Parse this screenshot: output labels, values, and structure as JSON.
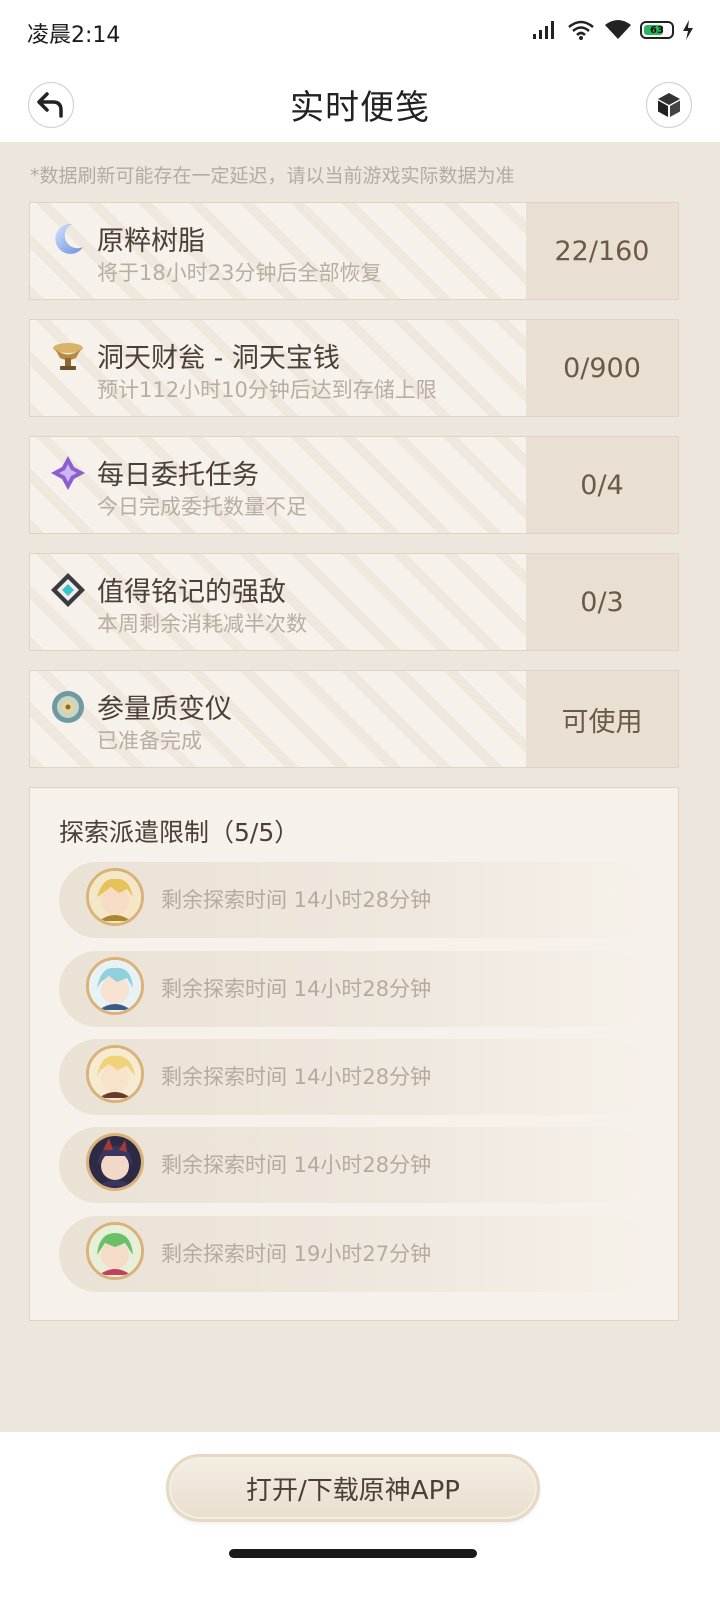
{
  "status_bar": {
    "time": "凌晨2:14",
    "battery": "63"
  },
  "header": {
    "title": "实时便笺"
  },
  "disclaimer": "*数据刷新可能存在一定延迟，请以当前游戏实际数据为准",
  "cards": [
    {
      "title": "原粹树脂",
      "subtitle": "将于18小时23分钟后全部恢复",
      "value": "22/160",
      "icon": "moon-icon"
    },
    {
      "title": "洞天财瓮 - 洞天宝钱",
      "subtitle": "预计112小时10分钟后达到存储上限",
      "value": "0/900",
      "icon": "teapot-icon"
    },
    {
      "title": "每日委托任务",
      "subtitle": "今日完成委托数量不足",
      "value": "0/4",
      "icon": "star-icon"
    },
    {
      "title": "值得铭记的强敌",
      "subtitle": "本周剩余消耗减半次数",
      "value": "0/3",
      "icon": "diamond-icon"
    },
    {
      "title": "参量质变仪",
      "subtitle": "已准备完成",
      "value": "可使用",
      "icon": "transformer-icon"
    }
  ],
  "expedition": {
    "title": "探索派遣限制（5/5）",
    "items": [
      {
        "text": "剩余探索时间 14小时28分钟",
        "avatar": "character-avatar-1"
      },
      {
        "text": "剩余探索时间 14小时28分钟",
        "avatar": "character-avatar-2"
      },
      {
        "text": "剩余探索时间 14小时28分钟",
        "avatar": "character-avatar-3"
      },
      {
        "text": "剩余探索时间 14小时28分钟",
        "avatar": "character-avatar-4"
      },
      {
        "text": "剩余探索时间 19小时27分钟",
        "avatar": "character-avatar-5"
      }
    ]
  },
  "footer": {
    "open_app_label": "打开/下载原神APP"
  },
  "colors": {
    "background": "#ede6dd",
    "card_value_bg": "#e9dfd2",
    "accent_brown": "#6b5a46"
  }
}
